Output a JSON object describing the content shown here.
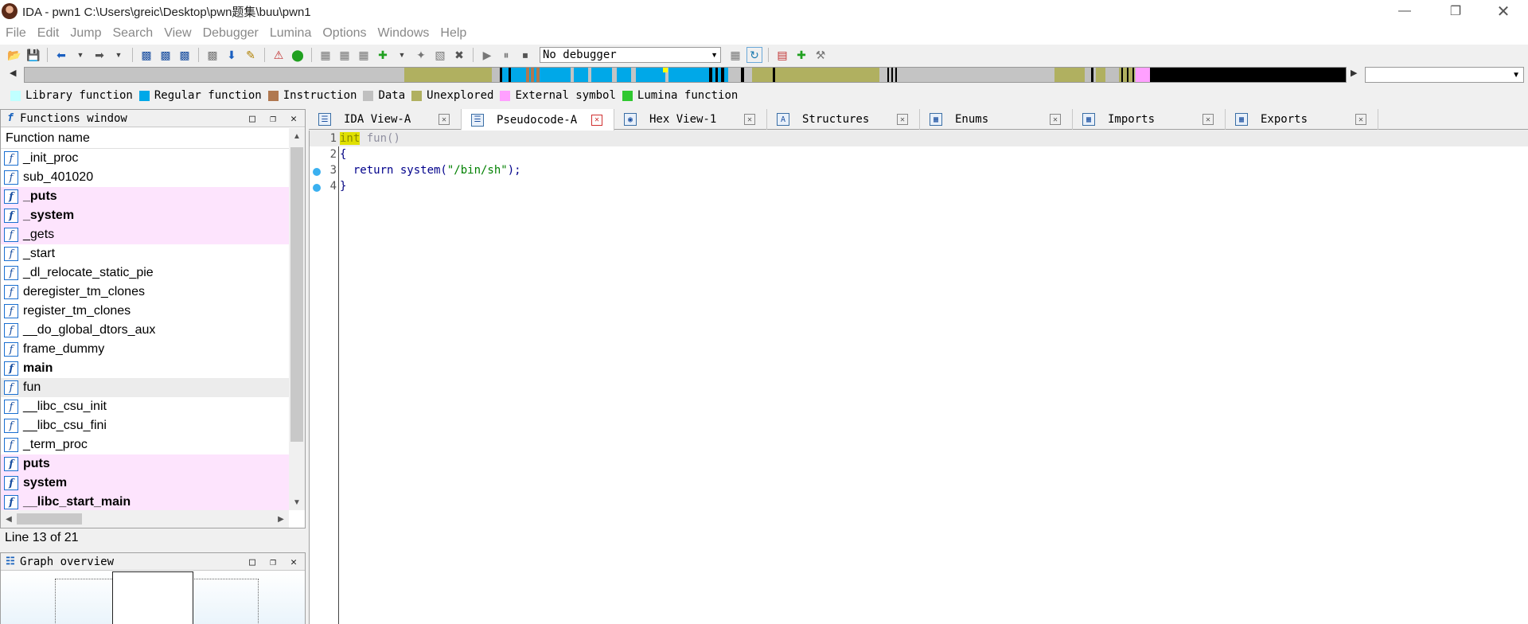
{
  "window": {
    "title": "IDA - pwn1 C:\\Users\\greic\\Desktop\\pwn题集\\buu\\pwn1"
  },
  "menu": [
    "File",
    "Edit",
    "Jump",
    "Search",
    "View",
    "Debugger",
    "Lumina",
    "Options",
    "Windows",
    "Help"
  ],
  "toolbar": {
    "debugger_select": "No debugger"
  },
  "legend": [
    {
      "label": "Library function",
      "color": "#c0ffff"
    },
    {
      "label": "Regular function",
      "color": "#00a8e8"
    },
    {
      "label": "Instruction",
      "color": "#b07850"
    },
    {
      "label": "Data",
      "color": "#c0c0c0"
    },
    {
      "label": "Unexplored",
      "color": "#b0b060"
    },
    {
      "label": "External symbol",
      "color": "#ffa0ff"
    },
    {
      "label": "Lumina function",
      "color": "#30c830"
    }
  ],
  "functions_window": {
    "title": "Functions window",
    "column_header": "Function name",
    "items": [
      {
        "name": "_init_proc",
        "style": "normal"
      },
      {
        "name": "sub_401020",
        "style": "normal"
      },
      {
        "name": "_puts",
        "style": "ext"
      },
      {
        "name": "_system",
        "style": "ext"
      },
      {
        "name": "_gets",
        "style": "ext-normal"
      },
      {
        "name": "_start",
        "style": "normal"
      },
      {
        "name": "_dl_relocate_static_pie",
        "style": "normal"
      },
      {
        "name": "deregister_tm_clones",
        "style": "normal"
      },
      {
        "name": "register_tm_clones",
        "style": "normal"
      },
      {
        "name": "__do_global_dtors_aux",
        "style": "normal"
      },
      {
        "name": "frame_dummy",
        "style": "normal"
      },
      {
        "name": "main",
        "style": "bold"
      },
      {
        "name": "fun",
        "style": "selected"
      },
      {
        "name": "__libc_csu_init",
        "style": "normal"
      },
      {
        "name": "__libc_csu_fini",
        "style": "normal"
      },
      {
        "name": "_term_proc",
        "style": "normal"
      },
      {
        "name": "puts",
        "style": "ext"
      },
      {
        "name": "system",
        "style": "ext"
      },
      {
        "name": "__libc_start_main",
        "style": "ext"
      }
    ],
    "status": "Line 13 of 21"
  },
  "graph_overview": {
    "title": "Graph overview"
  },
  "tabs": [
    {
      "label": "IDA View-A",
      "icon": "disassembly-icon",
      "active": false
    },
    {
      "label": "Pseudocode-A",
      "icon": "pseudocode-icon",
      "active": true
    },
    {
      "label": "Hex View-1",
      "icon": "hex-icon",
      "active": false
    },
    {
      "label": "Structures",
      "icon": "structures-icon",
      "active": false
    },
    {
      "label": "Enums",
      "icon": "enums-icon",
      "active": false
    },
    {
      "label": "Imports",
      "icon": "imports-icon",
      "active": false
    },
    {
      "label": "Exports",
      "icon": "exports-icon",
      "active": false
    }
  ],
  "code": {
    "lines": [
      {
        "num": "1",
        "keyword": "int",
        "rest": " fun()"
      },
      {
        "num": "2",
        "text": "{"
      },
      {
        "num": "3",
        "prefix": "  return system(",
        "string": "\"/bin/sh\"",
        "suffix": ");"
      },
      {
        "num": "4",
        "text": "}"
      }
    ]
  }
}
